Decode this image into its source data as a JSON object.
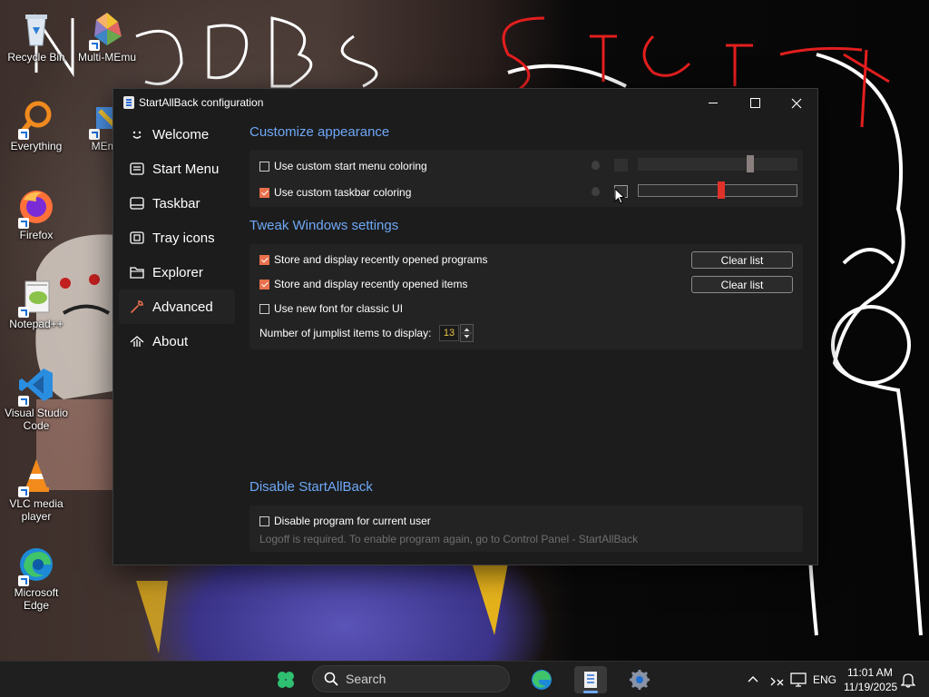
{
  "desktop": {
    "icons": [
      {
        "label": "Recycle Bin"
      },
      {
        "label": "Multi-MEmu"
      },
      {
        "label": "Everything"
      },
      {
        "label": "MEmu"
      },
      {
        "label": "Firefox"
      },
      {
        "label": "Notepad++"
      },
      {
        "label": "Visual Studio Code"
      },
      {
        "label": "VLC media player"
      },
      {
        "label": "Microsoft Edge"
      }
    ],
    "wallpaper_text": [
      "NOOB'S",
      "SECRET"
    ]
  },
  "window": {
    "title": "StartAllBack configuration",
    "controls": {
      "minimize": "minimize-icon",
      "maximize": "maximize-icon",
      "close": "close-icon"
    }
  },
  "sidebar": {
    "items": [
      {
        "label": "Welcome",
        "icon": "smile-icon"
      },
      {
        "label": "Start Menu",
        "icon": "start-menu-icon"
      },
      {
        "label": "Taskbar",
        "icon": "taskbar-icon"
      },
      {
        "label": "Tray icons",
        "icon": "tray-icon"
      },
      {
        "label": "Explorer",
        "icon": "folder-icon"
      },
      {
        "label": "Advanced",
        "icon": "wrench-icon",
        "active": true
      },
      {
        "label": "About",
        "icon": "about-icon"
      }
    ]
  },
  "appearance": {
    "title": "Customize appearance",
    "start_menu_coloring": {
      "label": "Use custom start menu coloring",
      "checked": false,
      "slider_value": 0.68
    },
    "taskbar_coloring": {
      "label": "Use custom taskbar coloring",
      "checked": true,
      "slider_value": 0.5
    },
    "colors": {
      "accent": "#e8704c",
      "slider_red": "#e0312b",
      "slider_gray": "#8a7f7f"
    }
  },
  "tweaks": {
    "title": "Tweak Windows settings",
    "recent_programs": {
      "label": "Store and display recently opened programs",
      "checked": true,
      "button": "Clear list"
    },
    "recent_items": {
      "label": "Store and display recently opened items",
      "checked": true,
      "button": "Clear list"
    },
    "classic_font": {
      "label": "Use new font for classic UI",
      "checked": false
    },
    "jumplist": {
      "label": "Number of jumplist items to display:",
      "value": "13"
    }
  },
  "disable": {
    "title": "Disable StartAllBack",
    "checkbox_label": "Disable program for current user",
    "note": "Logoff is required. To enable program again, go to Control Panel - StartAllBack"
  },
  "taskbar": {
    "search_placeholder": "Search",
    "language": "ENG",
    "time": "11:01 AM",
    "date": "11/19/2025"
  }
}
